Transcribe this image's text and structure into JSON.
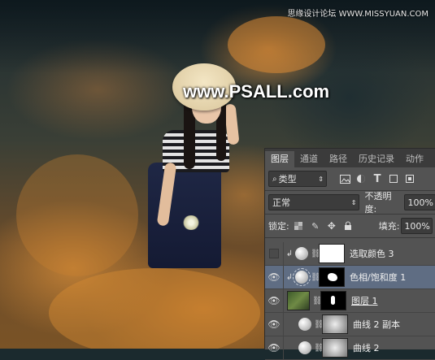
{
  "photo": {
    "watermark": "www.PSALL.com",
    "corner_mark": "思缘设计论坛 WWW.MISSYUAN.COM"
  },
  "layers_panel": {
    "tabs": [
      "图层",
      "通道",
      "路径",
      "历史记录",
      "动作"
    ],
    "active_tab": "图层",
    "filter": {
      "label": "类型",
      "icon": "search-icon"
    },
    "filter_icons": [
      "image-filter-icon",
      "adjustment-filter-icon",
      "type-filter-icon",
      "shape-filter-icon",
      "smart-object-filter-icon"
    ],
    "blend_mode": "正常",
    "opacity_label": "不透明度:",
    "opacity_value": "100%",
    "lock_label": "锁定:",
    "lock_icons": [
      "lock-transparent-icon",
      "lock-paint-icon",
      "lock-move-icon",
      "lock-all-icon"
    ],
    "fill_label": "填充:",
    "fill_value": "100%",
    "layers": [
      {
        "name": "选取颜色 3",
        "visible": false,
        "clipped": true,
        "type": "adjustment",
        "selected": false
      },
      {
        "name": "色相/饱和度 1",
        "visible": true,
        "clipped": true,
        "type": "adjustment",
        "selected": true
      },
      {
        "name": "图层 1",
        "visible": true,
        "clipped": false,
        "type": "pixel",
        "selected": false
      },
      {
        "name": "曲线 2 副本",
        "visible": true,
        "clipped": false,
        "type": "adjustment",
        "selected": false
      },
      {
        "name": "曲线 2",
        "visible": true,
        "clipped": false,
        "type": "adjustment",
        "selected": false
      }
    ]
  }
}
